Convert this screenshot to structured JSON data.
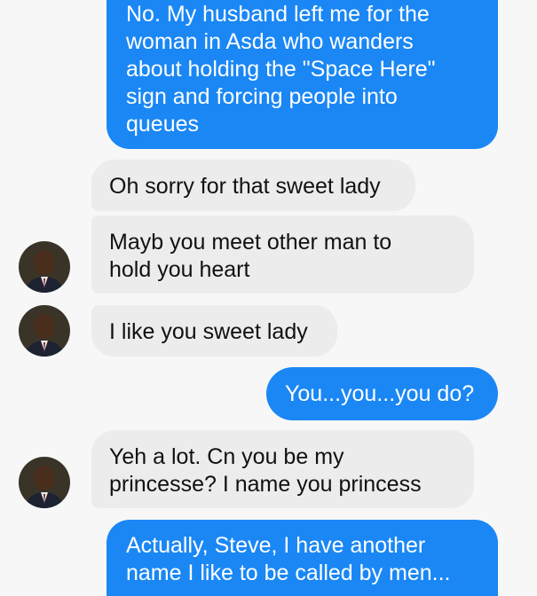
{
  "messages": [
    {
      "sender": "me",
      "text": "No. My husband left me for the\nwoman in Asda who wanders\nabout holding the \"Space Here\"\nsign and forcing people into\nqueues"
    },
    {
      "sender": "them",
      "text": "Oh sorry for that sweet lady"
    },
    {
      "sender": "them",
      "text": "Mayb you meet other man to\nhold you heart"
    },
    {
      "sender": "them",
      "text": "I like you sweet lady"
    },
    {
      "sender": "me",
      "text": "You...you...you do?"
    },
    {
      "sender": "them",
      "text": "Yeh a lot. Cn you be my\nprincesse? I name you princess"
    },
    {
      "sender": "me",
      "text": "Actually, Steve, I have another\nname I like to be called by men..."
    }
  ],
  "contact": {
    "avatar_icon": "person-avatar-icon"
  },
  "colors": {
    "outgoing_bubble": "#1a87f5",
    "incoming_bubble": "#ececec",
    "background": "#f7f7f7"
  }
}
